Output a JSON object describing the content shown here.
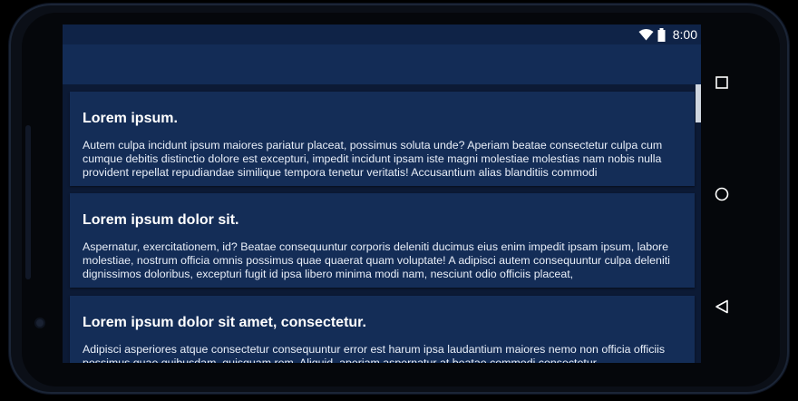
{
  "status_bar": {
    "time": "8:00",
    "icons": [
      "wifi-icon",
      "battery-icon"
    ]
  },
  "cards": [
    {
      "title": "Lorem ipsum.",
      "body": "Autem culpa incidunt ipsum maiores pariatur placeat, possimus soluta unde? Aperiam beatae consectetur culpa cum cumque debitis distinctio dolore est excepturi, impedit incidunt ipsam iste magni molestiae molestias nam nobis nulla provident repellat repudiandae similique tempora tenetur veritatis! Accusantium alias blanditiis commodi"
    },
    {
      "title": "Lorem ipsum dolor sit.",
      "body": "Aspernatur, exercitationem, id? Beatae consequuntur corporis deleniti ducimus eius enim impedit ipsam ipsum, labore molestiae, nostrum officia omnis possimus quae quaerat quam voluptate! A adipisci autem consequuntur culpa deleniti dignissimos doloribus, excepturi fugit id ipsa libero minima modi nam, nesciunt odio officiis placeat,"
    },
    {
      "title": "Lorem ipsum dolor sit amet, consectetur.",
      "body": "Adipisci asperiores atque consectetur consequuntur error est harum ipsa laudantium maiores nemo non officia officiis possimus quae quibusdam, quisquam rem. Aliquid, aperiam aspernatur at beatae commodi consectetur"
    }
  ],
  "nav_buttons": [
    "recents-square-icon",
    "home-circle-icon",
    "back-triangle-icon"
  ],
  "colors": {
    "status_bar": "#0f2347",
    "app_bar": "#132c56",
    "background": "#0c1a35",
    "card": "#142d57",
    "text": "#ffffff"
  }
}
